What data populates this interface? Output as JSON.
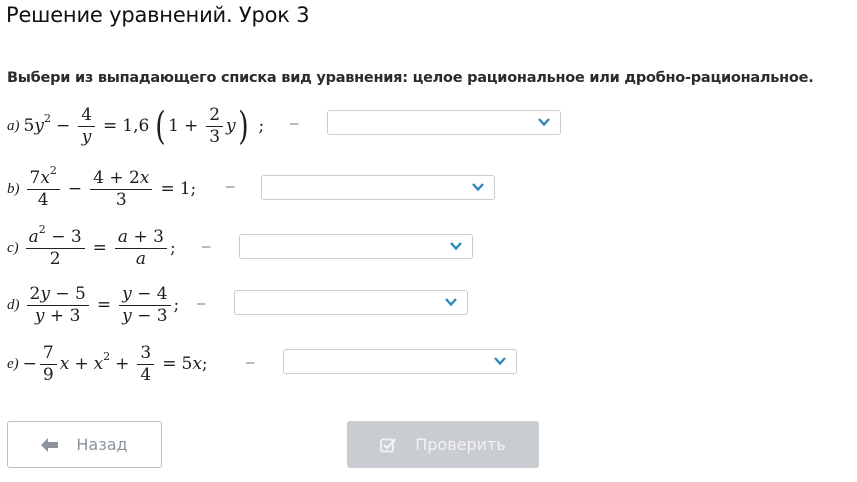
{
  "page": {
    "title": "Решение уравнений. Урок 3",
    "instruction": "Выбери из выпадающего списка вид уравнения: целое рациональное или дробно-рациональное."
  },
  "equations": [
    {
      "label": "a)",
      "separator": "–",
      "selected": ""
    },
    {
      "label": "b)",
      "separator": "–",
      "selected": ""
    },
    {
      "label": "c)",
      "separator": "–",
      "selected": ""
    },
    {
      "label": "d)",
      "separator": "–",
      "selected": ""
    },
    {
      "label": "e)",
      "separator": "–",
      "selected": ""
    }
  ],
  "buttons": {
    "back_label": "Назад",
    "check_label": "Проверить"
  },
  "icons": {
    "back": "arrow-left-icon",
    "check": "checkbox-icon",
    "dropdown": "chevron-down-icon"
  },
  "colors": {
    "dropdown_border": "#c7ccd3",
    "chevron": "#2f86b8",
    "check_button_bg": "#c9ccd0",
    "back_button_border": "#b9bec6"
  }
}
